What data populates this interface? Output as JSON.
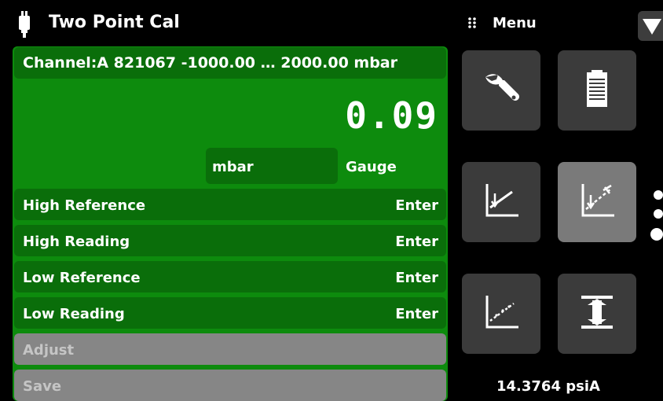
{
  "header": {
    "title": "Two Point Cal",
    "device_icon": "device-plug-icon"
  },
  "menu": {
    "label": "Menu",
    "grip_icon": "grip-dots-icon",
    "dropdown_icon": "triangle-down-icon"
  },
  "channel": {
    "text": "Channel:A 821067 -1000.00 … 2000.00 mbar"
  },
  "reading": {
    "value": "0.09",
    "unit": "mbar",
    "mode": "Gauge"
  },
  "rows": [
    {
      "label": "High Reference",
      "value": "Enter"
    },
    {
      "label": "High Reading",
      "value": "Enter"
    },
    {
      "label": "Low Reference",
      "value": "Enter"
    },
    {
      "label": "Low Reading",
      "value": "Enter"
    }
  ],
  "actions": {
    "adjust": "Adjust",
    "save": "Save"
  },
  "tiles": [
    {
      "icon": "wrench-icon"
    },
    {
      "icon": "clipboard-icon"
    },
    {
      "icon": "zero-adjust-graph-icon"
    },
    {
      "icon": "two-point-cal-graph-icon",
      "selected": true
    },
    {
      "icon": "linearity-graph-icon"
    },
    {
      "icon": "range-limits-icon"
    }
  ],
  "status": {
    "barometer": "14.3764 psiA"
  },
  "colors": {
    "panel_green": "#0d8b0d",
    "row_green": "#0a6e0a",
    "disabled_gray": "#868686",
    "tile_gray": "#3b3b3b",
    "tile_selected": "#7a7a7a"
  }
}
